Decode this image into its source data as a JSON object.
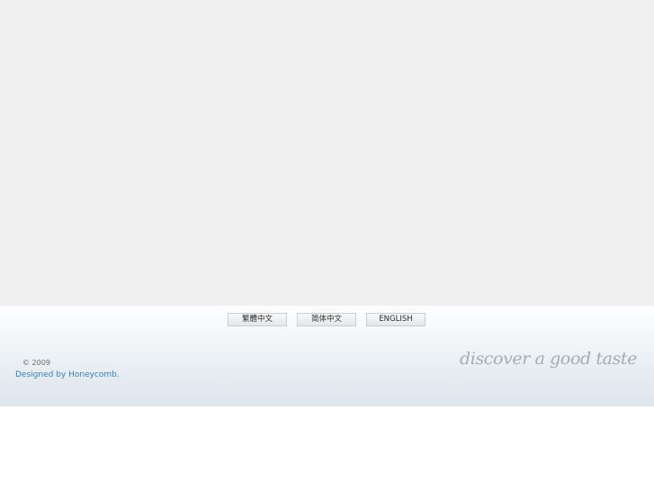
{
  "language_bar": {
    "buttons": [
      {
        "label": "繁體中文"
      },
      {
        "label": "简体中文"
      },
      {
        "label": "ENGLISH"
      }
    ]
  },
  "footer": {
    "copyright": "© 2009",
    "credit": "Designed by Honeycomb.",
    "tagline": "discover a good taste"
  },
  "colors": {
    "top_area": "#f0f0f0",
    "footer_gradient_top": "#fdfdfe",
    "footer_gradient_bottom": "#dde5ec",
    "link": "#3a7fb5",
    "tagline": "#a5acb3"
  }
}
